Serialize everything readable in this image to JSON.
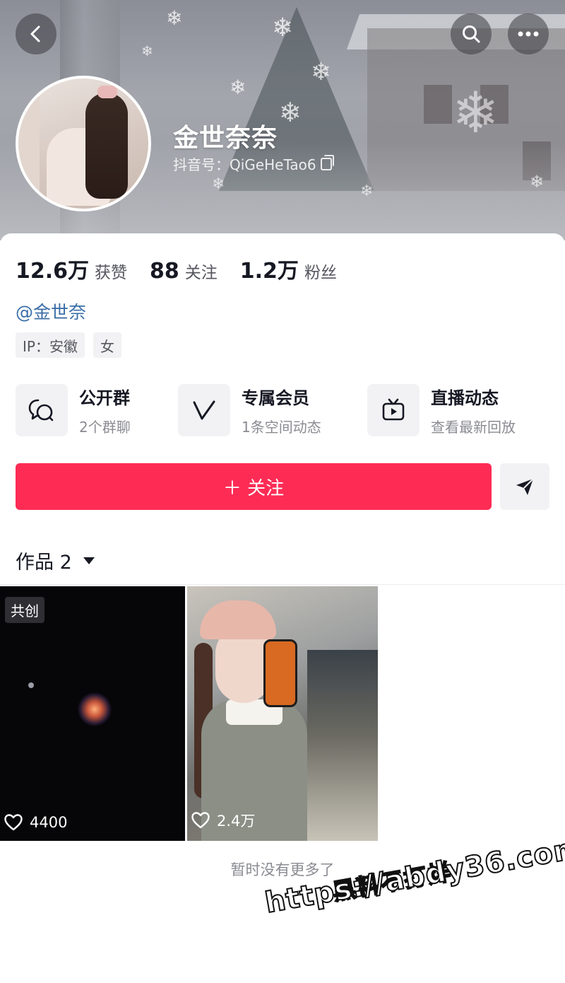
{
  "header": {
    "nickname": "金世奈奈",
    "douyin_id": "抖音号：QiGeHeTao6",
    "icons": [
      "back-icon",
      "search-icon",
      "more-icon",
      "copy-icon"
    ]
  },
  "stats": [
    {
      "value": "12.6万",
      "label": "获赞"
    },
    {
      "value": "88",
      "label": "关注"
    },
    {
      "value": "1.2万",
      "label": "粉丝"
    }
  ],
  "mention": "@金世奈",
  "tags": [
    "IP：安徽",
    "女"
  ],
  "features": [
    {
      "title": "公开群",
      "subtitle": "2个群聊",
      "icon": "group-chat-icon"
    },
    {
      "title": "专属会员",
      "subtitle": "1条空间动态",
      "icon": "vip-v-icon"
    },
    {
      "title": "直播动态",
      "subtitle": "查看最新回放",
      "icon": "live-tv-icon"
    }
  ],
  "actions": {
    "follow_label": "＋ 关注",
    "send_icon": "send-icon"
  },
  "works_tab": {
    "label": "作品 2"
  },
  "works": [
    {
      "badge": "共创",
      "likes": "4400"
    },
    {
      "badge": "",
      "likes": "2.4万"
    }
  ],
  "footer": {
    "no_more": "暂时没有更多了"
  },
  "watermark": {
    "line1": "黑料不打烊",
    "line2": "https://abdy36.com"
  },
  "colors": {
    "accent": "#fe2c55",
    "link": "#3b6ea8",
    "chip_bg": "#f2f2f4"
  }
}
